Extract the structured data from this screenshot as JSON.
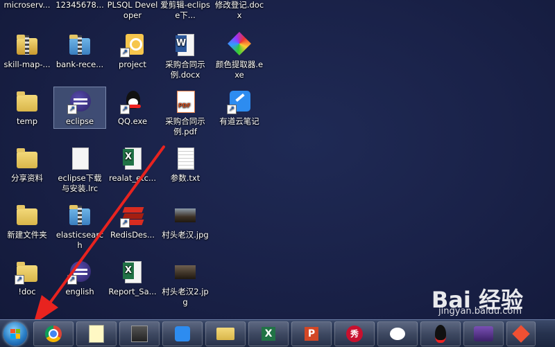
{
  "desktop": {
    "row0": [
      "microserv...",
      "12345678...",
      "PLSQL Developer",
      "爱剪辑-eclipse下...",
      "修改登记.docx"
    ],
    "icons": [
      {
        "label": "skill-map-...",
        "kind": "zip"
      },
      {
        "label": "bank-rece...",
        "kind": "zip"
      },
      {
        "label": "project",
        "kind": "plsql"
      },
      {
        "label": "采购合同示例.docx",
        "kind": "word"
      },
      {
        "label": "颜色提取器.exe",
        "kind": "color"
      },
      {
        "label": "temp",
        "kind": "folder"
      },
      {
        "label": "eclipse",
        "kind": "eclipse"
      },
      {
        "label": "QQ.exe",
        "kind": "qq"
      },
      {
        "label": "采购合同示例.pdf",
        "kind": "pdf"
      },
      {
        "label": "有道云笔记",
        "kind": "note"
      },
      {
        "label": "分享资料",
        "kind": "folder"
      },
      {
        "label": "eclipse下载与安装.lrc",
        "kind": "paper"
      },
      {
        "label": "realat_etc...",
        "kind": "excel"
      },
      {
        "label": "参数.txt",
        "kind": "paper"
      },
      {
        "label": "新建文件夹",
        "kind": "folder"
      },
      {
        "label": "elasticsearch",
        "kind": "zip"
      },
      {
        "label": "RedisDes...",
        "kind": "redis"
      },
      {
        "label": "村头老汉.jpg",
        "kind": "photo"
      },
      {
        "label": "!doc",
        "kind": "folder"
      },
      {
        "label": "english",
        "kind": "eclipse"
      },
      {
        "label": "Report_Sa...",
        "kind": "excel"
      },
      {
        "label": "村头老汉2.jpg",
        "kind": "photo"
      }
    ]
  },
  "watermark": {
    "brand": "Bai 经验",
    "url": "jingyan.baidu.com"
  },
  "taskbar": {
    "items": [
      {
        "name": "chrome-icon",
        "text": ""
      },
      {
        "name": "notepad-icon",
        "text": ""
      },
      {
        "name": "calc-icon",
        "text": ""
      },
      {
        "name": "youdao-icon",
        "text": ""
      },
      {
        "name": "explorer-icon",
        "text": ""
      },
      {
        "name": "excel-icon",
        "text": "X"
      },
      {
        "name": "powerpoint-icon",
        "text": "P"
      },
      {
        "name": "xiu-icon",
        "text": "秀"
      },
      {
        "name": "wechat-icon",
        "text": ""
      },
      {
        "name": "qq-icon",
        "text": ""
      },
      {
        "name": "eclipse-ide-icon",
        "text": ""
      },
      {
        "name": "git-icon",
        "text": ""
      }
    ]
  }
}
